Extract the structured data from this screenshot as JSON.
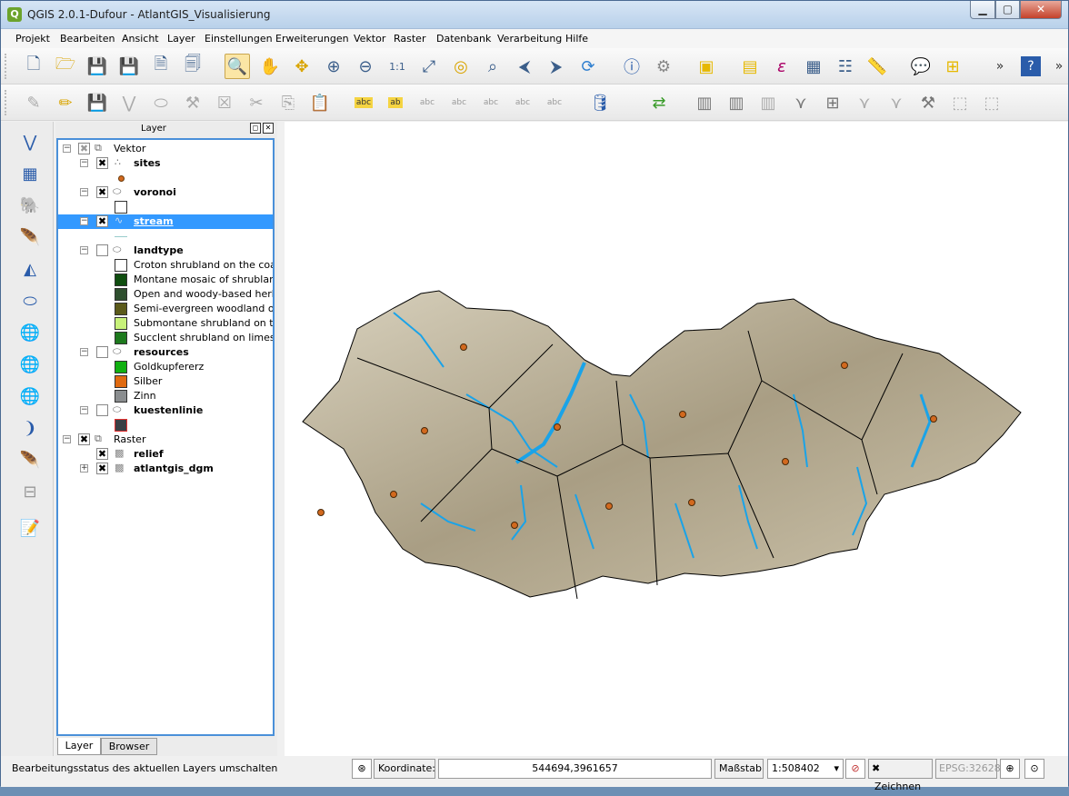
{
  "window": {
    "title": "QGIS 2.0.1-Dufour - AtlantGIS_Visualisierung",
    "app_icon": "Q"
  },
  "menu": [
    "Projekt",
    "Bearbeiten",
    "Ansicht",
    "Layer",
    "Einstellungen",
    "Erweiterungen",
    "Vektor",
    "Raster",
    "Datenbank",
    "Verarbeitung",
    "Hilfe"
  ],
  "toolbar1_icons": [
    "new-project",
    "open-project",
    "save-project",
    "save-as",
    "new-print-composer",
    "composer-manager",
    "pan-to-selection",
    "pan",
    "pan-map-to-selection",
    "zoom-in",
    "zoom-out",
    "zoom-native",
    "zoom-full",
    "zoom-to-layer",
    "zoom-to-selection",
    "zoom-last",
    "zoom-next",
    "refresh",
    "identify",
    "action",
    "select",
    "deselect",
    "expression-select",
    "attribute-table",
    "statistics",
    "measure",
    "annotation",
    "new-bookmark",
    "help"
  ],
  "toolbar2_icons": [
    "current-edits",
    "toggle-editing",
    "save-edits",
    "add-feature",
    "move-feature",
    "node-tool",
    "delete-selected",
    "cut-features",
    "copy-features",
    "paste-features",
    "label",
    "pin-labels",
    "show-hide-labels",
    "move-label",
    "rotate-label",
    "change-label",
    "db-manager",
    "sync",
    "plugin-1",
    "plugin-2",
    "plugin-3",
    "plugin-4",
    "plugin-5",
    "plugin-6",
    "plugin-7",
    "plugin-8",
    "plugin-9"
  ],
  "left_icons": [
    "add-vector",
    "add-raster",
    "add-postgis",
    "add-spatialite",
    "add-mssql",
    "add-oracle",
    "add-wms",
    "add-wcs",
    "add-wfs",
    "add-delimited",
    "new-shapefile",
    "remove-layer",
    "gps"
  ],
  "panel": {
    "title": "Layer",
    "float_label": "◻",
    "close_label": "✕"
  },
  "tree": {
    "vektor": "Vektor",
    "sites": "sites",
    "voronoi": "voronoi",
    "stream": "stream",
    "landtype": "landtype",
    "landtypes": [
      {
        "label": "Croton shrubland on the coa...",
        "color": "#0f4d0f"
      },
      {
        "label": "Montane mosaic of shrubland...",
        "color": "#2f4f2f"
      },
      {
        "label": "Open and woody-based herb...",
        "color": "#5b5a1a"
      },
      {
        "label": "Semi-evergreen woodland on...",
        "color": "#c8f27a"
      },
      {
        "label": "Submontane shrubland on th...",
        "color": "#1e7a1e"
      },
      {
        "label": "Succlent shrubland on limest...",
        "color": "#11b011"
      }
    ],
    "resources": "resources",
    "resource_items": [
      {
        "label": "Goldkupfererz",
        "color": "#e06a10"
      },
      {
        "label": "Silber",
        "color": "#8a8d8f"
      },
      {
        "label": "Zinn",
        "color": "#3a3f44"
      }
    ],
    "kuestenlinie": "kuestenlinie",
    "raster": "Raster",
    "relief": "relief",
    "dgm": "atlantgis_dgm"
  },
  "tabs": {
    "layer": "Layer",
    "browser": "Browser"
  },
  "status": {
    "message": "Bearbeitungsstatus des aktuellen Layers umschalten",
    "coord_label": "Koordinate:",
    "coord_value": "544694,3961657",
    "scale_label": "Maßstab",
    "scale_value": "1:508402",
    "render_label": "Zeichnen",
    "render_checked": "✖",
    "epsg": "EPSG:32628"
  },
  "map": {
    "relief_color": "#b8ad94",
    "stream_color": "#1aa3e8",
    "site_color": "#d2691e",
    "site_count": 12,
    "voronoi_color": "#000000"
  }
}
